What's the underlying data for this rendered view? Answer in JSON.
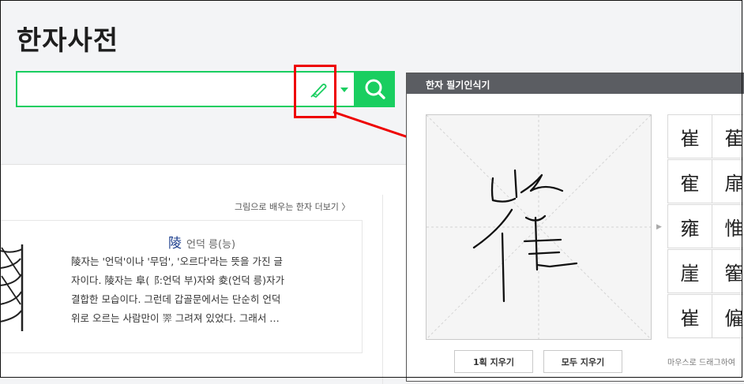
{
  "page": {
    "title": "한자사전"
  },
  "search": {
    "placeholder": ""
  },
  "content": {
    "more_link": "그림으로 배우는 한자 더보기 〉",
    "card": {
      "hanja": "陵",
      "reading": "언덕 릉(능)",
      "lines": [
        "陵자는 '언덕'이나 '무덤', '오르다'라는 뜻을 가진 글",
        "자이다. 陵자는 阜(⻏:언덕 부)자와 夌(언덕 릉)자가",
        "결합한 모습이다. 그런데 갑골문에서는 단순히 언덕",
        "위로 오르는 사람만이  𢍰  그려져 있었다. 그래서 …"
      ]
    }
  },
  "panel": {
    "title": "한자 필기인식기",
    "candidates": [
      [
        "崔",
        "萑"
      ],
      [
        "寉",
        "扉"
      ],
      [
        "雍",
        "惟"
      ],
      [
        "崖",
        "篧"
      ],
      [
        "崔",
        "僱"
      ]
    ],
    "clear_stroke_label": "1획 지우기",
    "clear_all_label": "모두 지우기",
    "hint": "마우스로 드래그하여"
  },
  "colors": {
    "brand_green": "#19ce60",
    "highlight_red": "#ee0000",
    "panel_bar": "#5b5d62"
  },
  "icons": {
    "pen": "pen-icon",
    "dropdown": "caret-down-icon",
    "search": "search-icon"
  }
}
